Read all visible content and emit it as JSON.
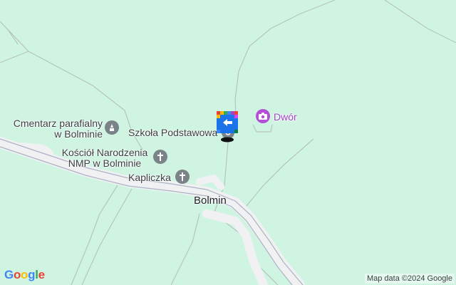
{
  "map": {
    "background_color": "#cff5e2",
    "road_color": "#f2f2f4",
    "labels": {
      "cemetery": "Cmentarz parafialny\nw Bolminie",
      "school": "Szkoła Podstawowa",
      "church": "Kościół Narodzenia\nNMP w Bolminie",
      "chapel": "Kapliczka",
      "manor": "Dwór",
      "town": "Bolmin"
    },
    "icons": {
      "cemetery": "cemetery-icon",
      "church": "church-cross-icon",
      "chapel": "chapel-cross-icon",
      "manor": "camera-icon",
      "pin": "street-view-pin-icon"
    }
  },
  "footer": {
    "logo_letters": [
      "G",
      "o",
      "o",
      "g",
      "l",
      "e"
    ],
    "logo_colors": [
      "#4285f4",
      "#ea4335",
      "#fbbc05",
      "#4285f4",
      "#34a853",
      "#ea4335"
    ],
    "attribution": "Map data ©2024 Google"
  }
}
